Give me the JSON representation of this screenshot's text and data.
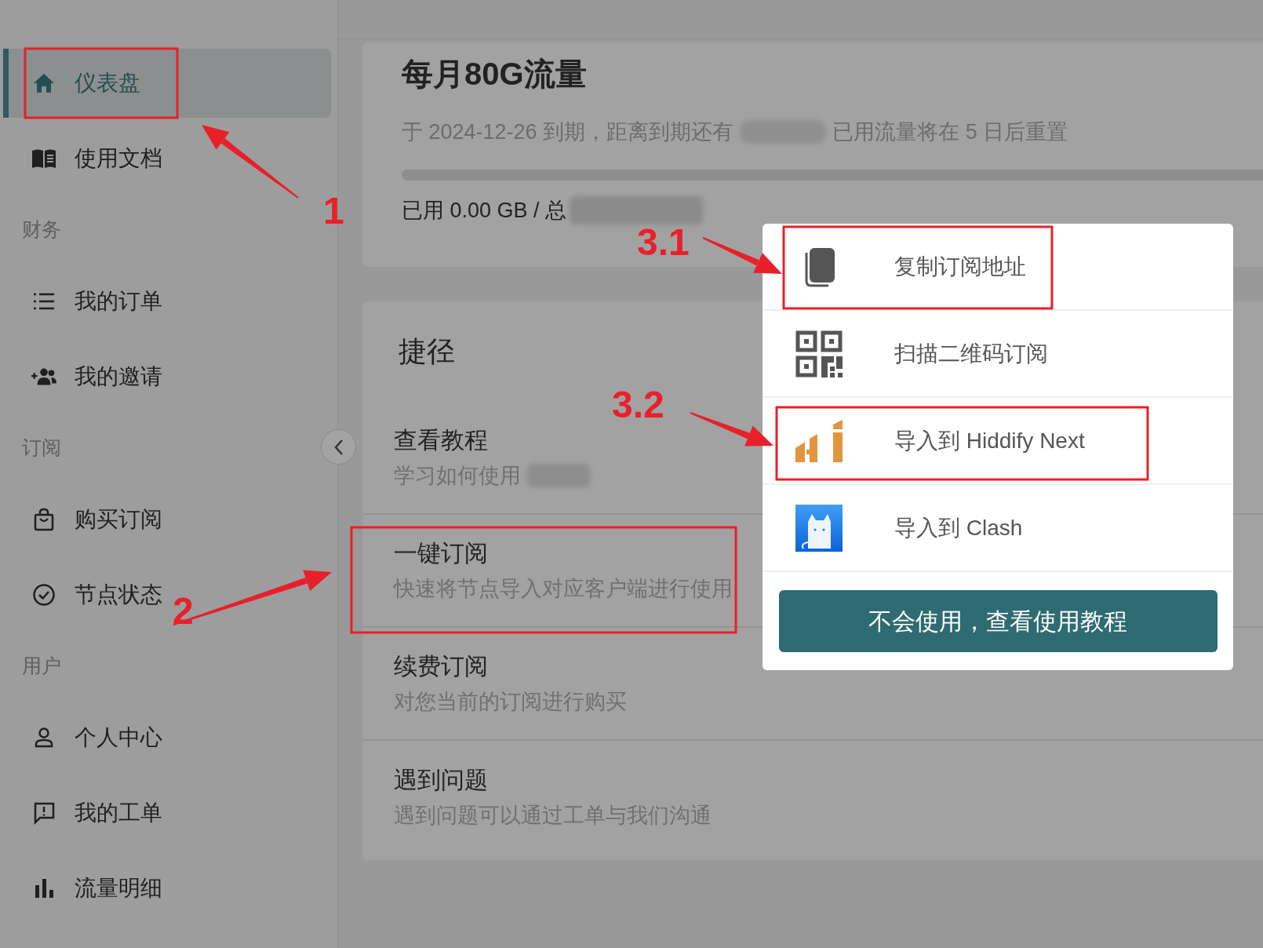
{
  "sidebar": {
    "items": [
      {
        "kind": "item",
        "label": "仪表盘",
        "selected": true
      },
      {
        "kind": "item",
        "label": "使用文档",
        "selected": false
      },
      {
        "kind": "section",
        "label": "财务"
      },
      {
        "kind": "item",
        "label": "我的订单",
        "selected": false
      },
      {
        "kind": "item",
        "label": "我的邀请",
        "selected": false
      },
      {
        "kind": "section",
        "label": "订阅"
      },
      {
        "kind": "item",
        "label": "购买订阅",
        "selected": false
      },
      {
        "kind": "item",
        "label": "节点状态",
        "selected": false
      },
      {
        "kind": "section",
        "label": "用户"
      },
      {
        "kind": "item",
        "label": "个人中心",
        "selected": false
      },
      {
        "kind": "item",
        "label": "我的工单",
        "selected": false
      },
      {
        "kind": "item",
        "label": "流量明细",
        "selected": false
      }
    ]
  },
  "plan_card": {
    "title": "每月80G流量",
    "expiry_text": "于 2024-12-26 到期，距离到期还有",
    "reset_text": "已用流量将在 5 日后重置",
    "usage_text": "已用 0.00 GB / 总"
  },
  "shortcuts": {
    "title": "捷径",
    "items": [
      {
        "title": "查看教程",
        "description": "学习如何使用"
      },
      {
        "title": "一键订阅",
        "description": "快速将节点导入对应客户端进行使用"
      },
      {
        "title": "续费订阅",
        "description": "对您当前的订阅进行购买"
      },
      {
        "title": "遇到问题",
        "description": "遇到问题可以通过工单与我们沟通"
      }
    ]
  },
  "subscribe_menu": {
    "options": [
      {
        "label": "复制订阅地址"
      },
      {
        "label": "扫描二维码订阅"
      },
      {
        "label": "导入到 Hiddify Next"
      },
      {
        "label": "导入到 Clash"
      }
    ],
    "help_button": "不会使用，查看使用教程"
  },
  "annotations": [
    {
      "label": "1"
    },
    {
      "label": "2"
    },
    {
      "label": "3.1"
    },
    {
      "label": "3.2"
    }
  ]
}
